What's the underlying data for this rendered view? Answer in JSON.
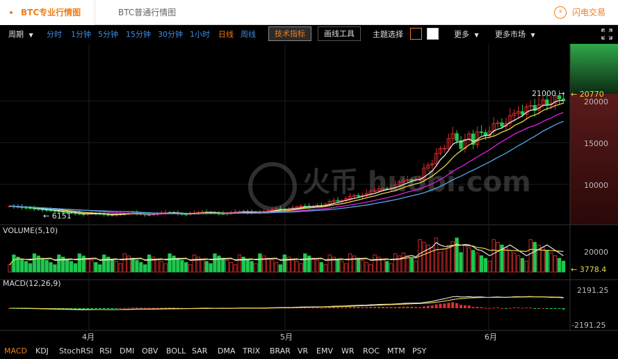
{
  "tabs": [
    {
      "label": "BTC专业行情图",
      "active": true
    },
    {
      "label": "BTC普通行情图",
      "active": false
    }
  ],
  "brand": {
    "label": "闪电交易",
    "icon": "lightning-icon"
  },
  "toolbar": {
    "period_label": "周期",
    "periods": [
      "分时",
      "1分钟",
      "5分钟",
      "15分钟",
      "30分钟",
      "1小时",
      "日线",
      "周线"
    ],
    "active_period": "日线",
    "tech_button": "技术指标",
    "draw_button": "画线工具",
    "theme_label": "主题选择",
    "more_label": "更多",
    "more_market_label": "更多市场"
  },
  "colors": {
    "accent": "#ee7f1a",
    "up": "#e02d2d",
    "down": "#1ec84f",
    "ma_white": "#e8e8e8",
    "ma_yellow": "#e8d94a",
    "ma_magenta": "#e020e0",
    "ma_blue": "#55a8e8"
  },
  "price_panel": {
    "y_ticks": [
      "20000",
      "15000",
      "10000"
    ],
    "y_tick_values": [
      20000,
      15000,
      10000
    ],
    "current_price": "20770",
    "high_label": "21000",
    "low_label": "6151"
  },
  "volume_panel": {
    "label": "VOLUME(5,10)",
    "tick": "20000",
    "current": "3778.4"
  },
  "macd_panel": {
    "label": "MACD(12,26,9)",
    "tick_top": "2191.25",
    "tick_bottom": "-2191.25"
  },
  "x_axis": [
    "4月",
    "5月",
    "6月"
  ],
  "indicators": [
    "MACD",
    "KDJ",
    "StochRSI",
    "RSI",
    "DMI",
    "OBV",
    "BOLL",
    "SAR",
    "DMA",
    "TRIX",
    "BRAR",
    "VR",
    "EMV",
    "WR",
    "ROC",
    "MTM",
    "PSY"
  ],
  "active_indicator": "MACD",
  "watermark": "火币 huobi.com"
}
